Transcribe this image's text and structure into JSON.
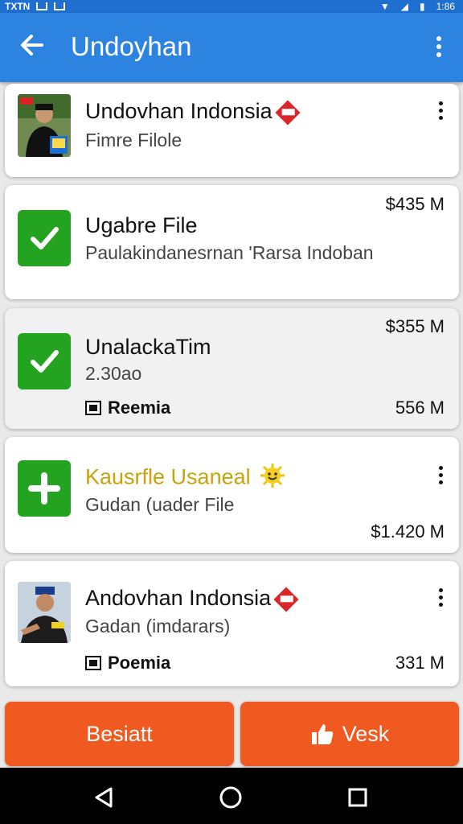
{
  "status_bar": {
    "left_text": "TXTN",
    "right_time": "1:86"
  },
  "app_bar": {
    "title": "Undoyhan"
  },
  "items": [
    {
      "title": "Undovhan Indonsia",
      "subtitle": "Fimre Filole",
      "icon": "profile-thumbnail"
    },
    {
      "title": "Ugabre File",
      "subtitle": "Paulakindanesrnan 'Rarsa Indoban",
      "price": "$435 M",
      "icon": "check-icon"
    },
    {
      "title": "UnalackaTim",
      "subtitle": "2.30ao",
      "price": "$355 M",
      "meta": "Reemia",
      "size": "556 M",
      "icon": "check-icon"
    },
    {
      "title": "Kausrfle Usaneal",
      "subtitle": "Gudan (uader File",
      "price": "$1.420 M",
      "icon": "plus-icon",
      "title_color": "#c9a20a"
    },
    {
      "title": "Andovhan Indonsia",
      "subtitle": "Gadan (imdarars)",
      "meta": "Poemia",
      "size": "331 M",
      "icon": "profile-thumbnail"
    }
  ],
  "buttons": {
    "left": "Besiatt",
    "right": "Vesk"
  },
  "colors": {
    "app_bar": "#2d84e0",
    "status_bar": "#1f6fd1",
    "check_green": "#23a31f",
    "button_orange": "#f0591f"
  }
}
